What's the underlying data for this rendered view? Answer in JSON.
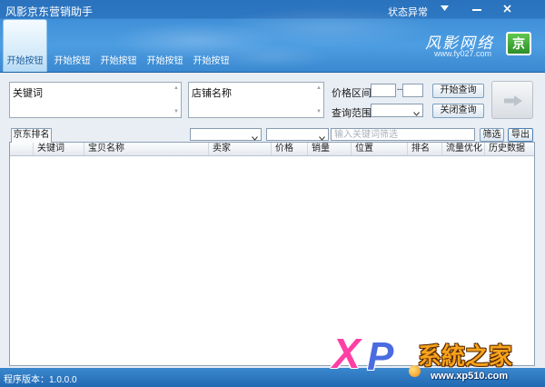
{
  "window": {
    "title": "风影京东营销助手",
    "status": "状态异常",
    "controls": [
      "dropdown-icon",
      "minimize-icon",
      "close-icon"
    ]
  },
  "tabs": [
    {
      "label": "开始按钮",
      "active": true
    },
    {
      "label": "开始按钮",
      "active": false
    },
    {
      "label": "开始按钮",
      "active": false
    },
    {
      "label": "开始按钮",
      "active": false
    },
    {
      "label": "开始按钮",
      "active": false
    }
  ],
  "logo": {
    "name": "风影网络",
    "url": "www.fy027.com",
    "badge": "京"
  },
  "query": {
    "keyword_text": "关键词",
    "shop_text": "店铺名称",
    "price_label": "价格区间",
    "price_min": "",
    "price_separator": "--",
    "price_max": "",
    "range_label": "查询范围",
    "range_value": "",
    "start_button": "开始查询",
    "stop_button": "关闭查询",
    "go_button_icon": "arrow-right-icon"
  },
  "filter": {
    "tab_label": "京东排名",
    "select_1_value": "",
    "select_2_value": "",
    "search_placeholder": "输入关键词筛选",
    "filter_button": "筛选",
    "export_button": "导出"
  },
  "table": {
    "columns": [
      "",
      "关键词",
      "宝贝名称",
      "卖家",
      "价格",
      "销量",
      "位置",
      "排名",
      "流量优化",
      "历史数据"
    ],
    "rows": []
  },
  "status_bar": {
    "version": "程序版本：1.0.0.0"
  },
  "watermark": {
    "letters": [
      "X",
      "P"
    ],
    "name": "系統之家",
    "url": "www.xp510.com"
  },
  "colors": {
    "title_blue": "#2a72bd",
    "header_blue": "#3f90d8",
    "status_blue": "#2a78c2",
    "badge_green": "#3aa33a",
    "active_tab_text": "#1c5b9b",
    "watermark_pink": "#ff3fa4",
    "watermark_orange": "#f7a31c"
  }
}
